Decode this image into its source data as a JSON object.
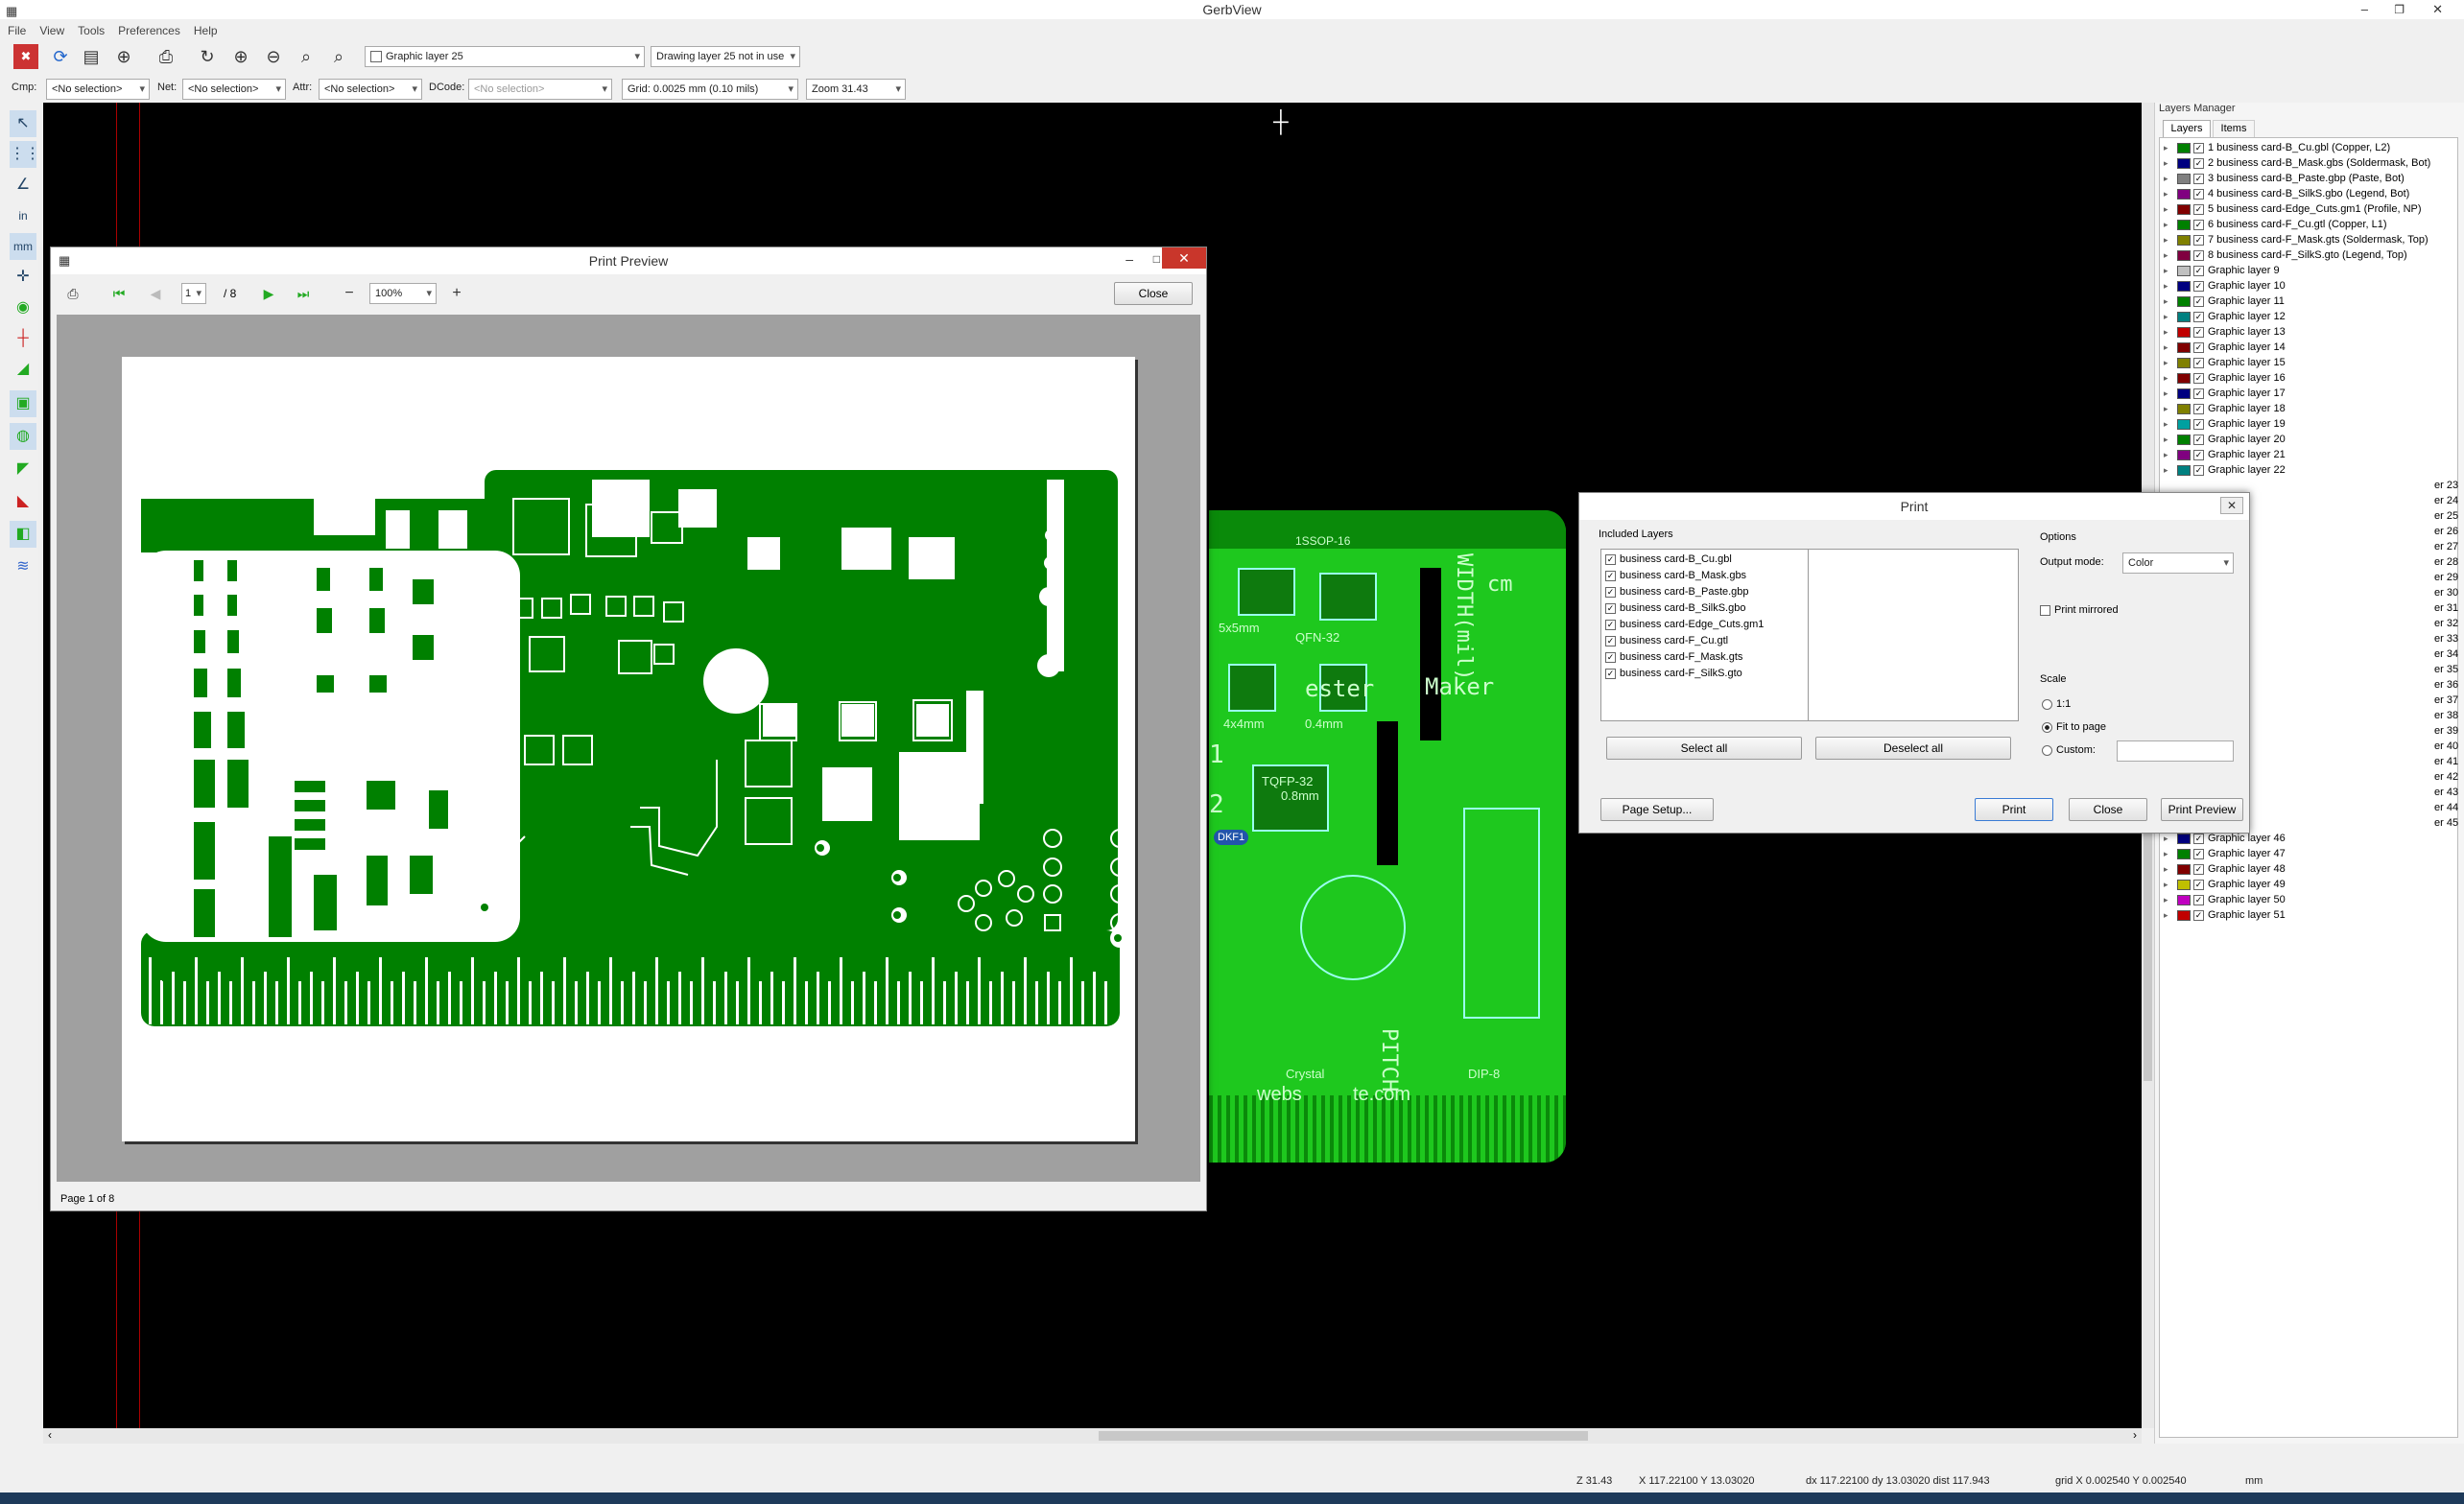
{
  "app": {
    "title": "GerbView"
  },
  "menu": [
    "File",
    "View",
    "Tools",
    "Preferences",
    "Help"
  ],
  "toolbar": {
    "layer_select": "Graphic layer 25",
    "drawing_layer": "Drawing layer 25 not in use"
  },
  "selectors": {
    "cmp_label": "Cmp:",
    "cmp_value": "<No selection>",
    "net_label": "Net:",
    "net_value": "<No selection>",
    "attr_label": "Attr:",
    "attr_value": "<No selection>",
    "dcode_label": "DCode:",
    "dcode_value": "<No selection>",
    "grid_value": "Grid: 0.0025 mm (0.10 mils)",
    "zoom_value": "Zoom 31.43"
  },
  "layers_manager": {
    "title": "Layers Manager",
    "tabs": [
      "Layers",
      "Items"
    ],
    "layers": [
      {
        "name": "1 business card-B_Cu.gbl (Copper, L2)",
        "color": "#008000"
      },
      {
        "name": "2 business card-B_Mask.gbs (Soldermask, Bot)",
        "color": "#000080"
      },
      {
        "name": "3 business card-B_Paste.gbp (Paste, Bot)",
        "color": "#808080"
      },
      {
        "name": "4 business card-B_SilkS.gbo (Legend, Bot)",
        "color": "#800080"
      },
      {
        "name": "5 business card-Edge_Cuts.gm1 (Profile, NP)",
        "color": "#800000"
      },
      {
        "name": "6 business card-F_Cu.gtl (Copper, L1)",
        "color": "#008000"
      },
      {
        "name": "7 business card-F_Mask.gts (Soldermask, Top)",
        "color": "#808000"
      },
      {
        "name": "8 business card-F_SilkS.gto (Legend, Top)",
        "color": "#800040"
      },
      {
        "name": "Graphic layer 9",
        "color": "#c0c0c0"
      },
      {
        "name": "Graphic layer 10",
        "color": "#000080"
      },
      {
        "name": "Graphic layer 11",
        "color": "#008000"
      },
      {
        "name": "Graphic layer 12",
        "color": "#008080"
      },
      {
        "name": "Graphic layer 13",
        "color": "#c00000"
      },
      {
        "name": "Graphic layer 14",
        "color": "#800000"
      },
      {
        "name": "Graphic layer 15",
        "color": "#808000"
      },
      {
        "name": "Graphic layer 16",
        "color": "#800000"
      },
      {
        "name": "Graphic layer 17",
        "color": "#000080"
      },
      {
        "name": "Graphic layer 18",
        "color": "#808000"
      },
      {
        "name": "Graphic layer 19",
        "color": "#00a0a0"
      },
      {
        "name": "Graphic layer 20",
        "color": "#008000"
      },
      {
        "name": "Graphic layer 21",
        "color": "#800080"
      },
      {
        "name": "Graphic layer 22",
        "color": "#008080"
      }
    ],
    "partial_layers": [
      "er 23",
      "er 24",
      "er 25",
      "er 26",
      "er 27",
      "er 28",
      "er 29",
      "er 30",
      "er 31",
      "er 32",
      "er 33",
      "er 34",
      "er 35",
      "er 36",
      "er 37",
      "er 38",
      "er 39",
      "er 40",
      "er 41",
      "er 42",
      "er 43",
      "er 44",
      "er 45"
    ],
    "bottom_layers": [
      {
        "name": "Graphic layer 46",
        "color": "#000080"
      },
      {
        "name": "Graphic layer 47",
        "color": "#008000"
      },
      {
        "name": "Graphic layer 48",
        "color": "#800000"
      },
      {
        "name": "Graphic layer 49",
        "color": "#c0c000"
      },
      {
        "name": "Graphic layer 50",
        "color": "#c000c0"
      },
      {
        "name": "Graphic layer 51",
        "color": "#c00000"
      }
    ]
  },
  "print_preview": {
    "title": "Print Preview",
    "page_value": "1",
    "page_total": "/ 8",
    "zoom": "100%",
    "close": "Close",
    "status": "Page 1 of 8"
  },
  "print_dialog": {
    "title": "Print",
    "included_layers_label": "Included Layers",
    "layers": [
      "business card-B_Cu.gbl",
      "business card-B_Mask.gbs",
      "business card-B_Paste.gbp",
      "business card-B_SilkS.gbo",
      "business card-Edge_Cuts.gm1",
      "business card-F_Cu.gtl",
      "business card-F_Mask.gts",
      "business card-F_SilkS.gto"
    ],
    "select_all": "Select all",
    "deselect_all": "Deselect all",
    "options_label": "Options",
    "output_mode_label": "Output mode:",
    "output_mode": "Color",
    "print_mirrored": "Print mirrored",
    "scale_label": "Scale",
    "scale_1_1": "1:1",
    "scale_fit": "Fit to page",
    "scale_custom": "Custom:",
    "page_setup": "Page Setup...",
    "print": "Print",
    "close": "Close",
    "print_preview": "Print Preview"
  },
  "board_text": [
    "cm",
    "Maker",
    "ester",
    "WIDTH(mil)",
    "PITCH",
    "5x5mm",
    "QFN-32",
    "4x4mm",
    "0.4mm",
    "TQFP-32",
    "0.8mm",
    "Crystal",
    "DIP-8",
    "1",
    "2",
    "webs",
    "te.com",
    "1SSOP-16",
    "DKF1"
  ],
  "statusbar": {
    "zoom": "Z 31.43",
    "xy": "X 117.22100  Y 13.03020",
    "dxy": "dx 117.22100  dy 13.03020  dist 117.943",
    "grid": "grid X 0.002540  Y 0.002540",
    "units": "mm"
  }
}
